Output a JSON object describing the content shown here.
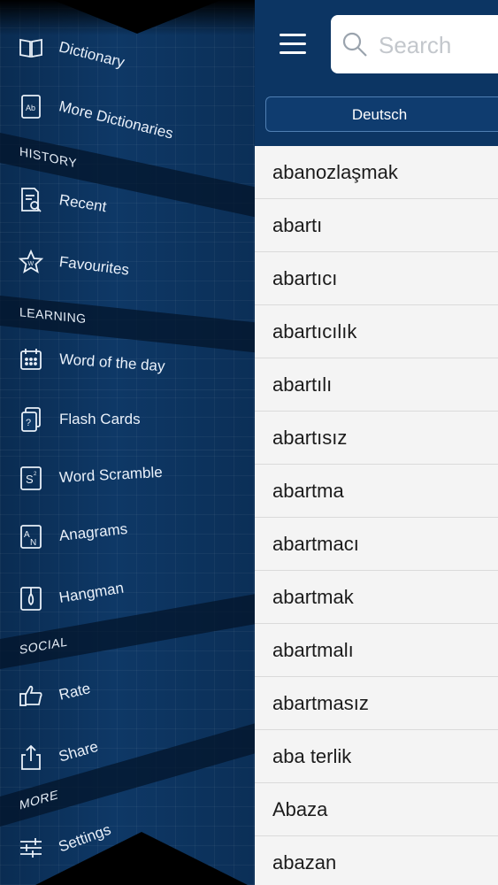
{
  "sidebar": {
    "items": [
      {
        "label": "Dictionary",
        "icon": "book-icon"
      },
      {
        "label": "More Dictionaries",
        "icon": "ab-dictionary-icon"
      },
      {
        "label": "Recent",
        "icon": "recent-icon"
      },
      {
        "label": "Favourites",
        "icon": "star-icon"
      },
      {
        "label": "Word of the day",
        "icon": "calendar-icon"
      },
      {
        "label": "Flash Cards",
        "icon": "flash-cards-icon"
      },
      {
        "label": "Word Scramble",
        "icon": "scramble-icon"
      },
      {
        "label": "Anagrams",
        "icon": "anagrams-icon"
      },
      {
        "label": "Hangman",
        "icon": "hangman-icon"
      },
      {
        "label": "Rate",
        "icon": "thumbs-up-icon"
      },
      {
        "label": "Share",
        "icon": "share-icon"
      },
      {
        "label": "Settings",
        "icon": "settings-sliders-icon"
      }
    ],
    "sections": {
      "history": "HISTORY",
      "learning": "LEARNING",
      "social": "SOCIAL",
      "more": "MORE"
    }
  },
  "header": {
    "search_placeholder": "Search",
    "language_tab": "Deutsch"
  },
  "words": [
    "abanozlaşmak",
    "abartı",
    "abartıcı",
    "abartıcılık",
    "abartılı",
    "abartısız",
    "abartma",
    "abartmacı",
    "abartmak",
    "abartmalı",
    "abartmasız",
    "aba terlik",
    "Abaza",
    "abazan"
  ],
  "colors": {
    "sidebar_bg": "#0e3866",
    "header_bg": "#0c3563",
    "list_bg": "#f4f4f4"
  }
}
